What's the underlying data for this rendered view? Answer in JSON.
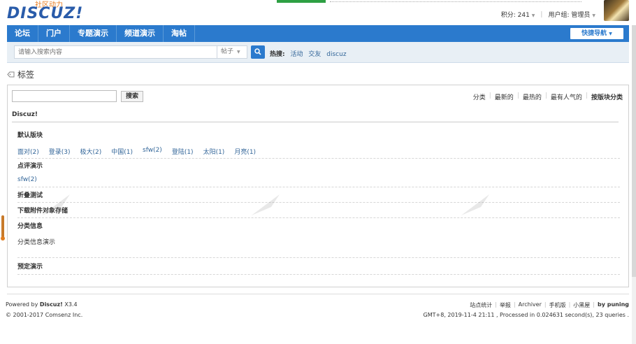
{
  "header": {
    "slogan": "社区动力",
    "brand": "DISCUZ!",
    "points_label": "积分: 241",
    "usergroup_label": "用户组: 管理员"
  },
  "nav": {
    "items": [
      "论坛",
      "门户",
      "专题演示",
      "频道演示",
      "淘帖"
    ],
    "quick_nav": "快捷导航"
  },
  "search": {
    "placeholder": "请输入搜索内容",
    "type": "帖子",
    "hot_label": "热搜:",
    "hot_terms": [
      "活动",
      "交友",
      "discuz"
    ]
  },
  "page_title": "标签",
  "tag_search": {
    "button": "搜索"
  },
  "tabs": [
    "分类",
    "最新的",
    "最热的",
    "最有人气的",
    "按版块分类"
  ],
  "category": "Discuz!",
  "sections": [
    {
      "title": "默认版块",
      "tags": [
        "面对(2)",
        "登录(3)",
        "极大(2)",
        "中国(1)",
        "sfw(2)",
        "登陆(1)",
        "太阳(1)",
        "月亮(1)"
      ]
    },
    {
      "title": "点评演示",
      "tags": [
        "sfw(2)"
      ]
    },
    {
      "title": "折叠测试"
    },
    {
      "title": "下载附件对象存储"
    },
    {
      "title": "分类信息",
      "text": "分类信息演示"
    },
    {
      "title": "预定演示"
    }
  ],
  "footer": {
    "powered_prefix": "Powered by",
    "powered_brand": "Discuz!",
    "powered_version": "X3.4",
    "copyright": "© 2001-2017 Comsenz Inc.",
    "links": [
      "站点统计",
      "举报",
      "Archiver",
      "手机版",
      "小黑屋"
    ],
    "by": "by puning",
    "gmt": "GMT+8, 2019-11-4 21:11 , Processed in 0.024631 second(s), 23 queries ."
  },
  "colors": {
    "nav_bg": "#2b7acd",
    "link": "#336699",
    "searchbar_bg": "#e8eff5"
  }
}
